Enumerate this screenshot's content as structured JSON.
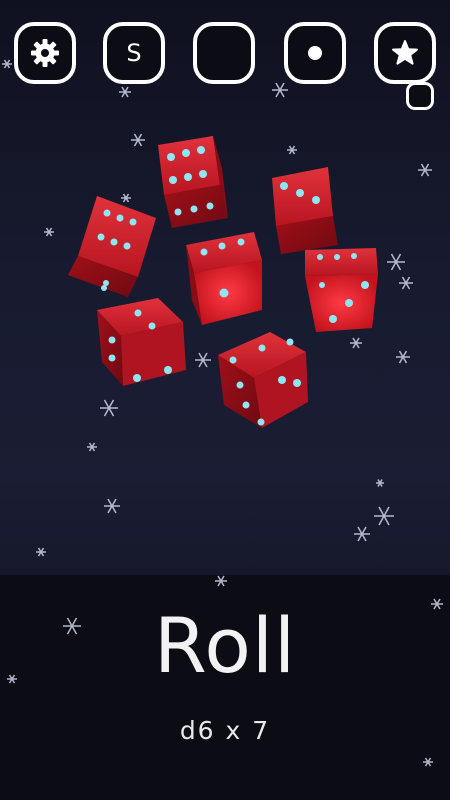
{
  "toolbar": {
    "settings_icon": "gear-icon",
    "s_button_label": "S",
    "blank_icon": "rounded-square-icon",
    "dot_icon": "dot-icon",
    "star_icon": "star-icon",
    "small_icon": "small-square-icon"
  },
  "roll": {
    "label": "Roll",
    "dice_spec": "d6 x 7"
  },
  "dice": {
    "count": 7,
    "sides": 6,
    "color": "#c8141e",
    "pip_color": "#8fe6f2"
  },
  "colors": {
    "background": "#161a2e",
    "panel": "#0b0c14",
    "button_border": "#ffffff"
  }
}
